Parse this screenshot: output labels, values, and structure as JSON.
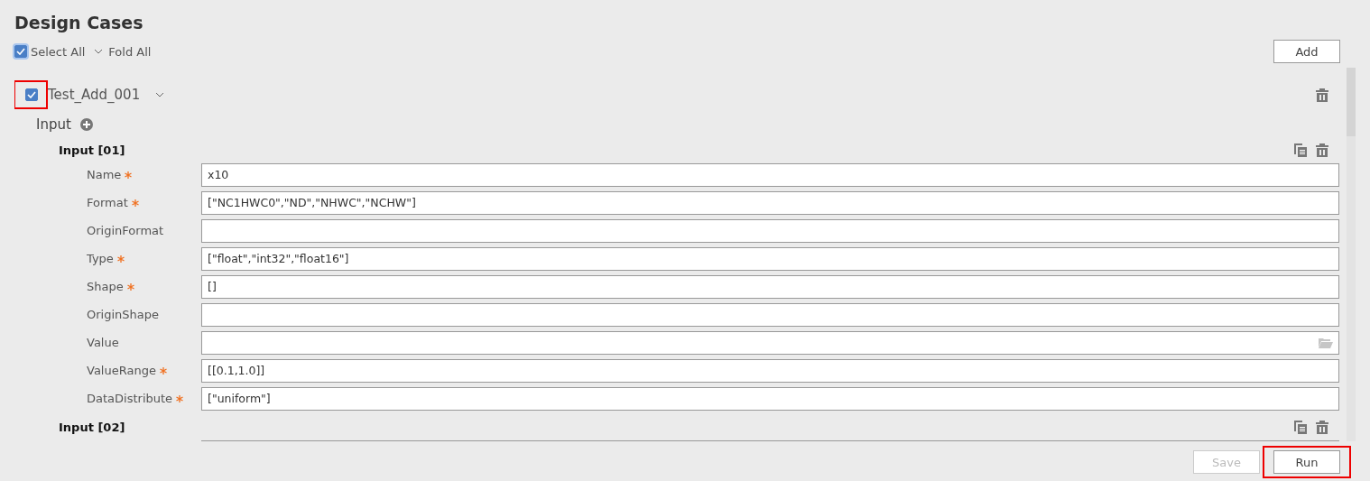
{
  "title": "Design Cases",
  "toolbar": {
    "select_all": {
      "label": "Select All",
      "checked": true
    },
    "fold_all": {
      "label": "Fold All"
    },
    "add_button": "Add"
  },
  "case": {
    "name": "Test_Add_001",
    "checked": true,
    "highlighted": true,
    "expanded": true,
    "input_section": {
      "label": "Input",
      "inputs": [
        {
          "title": "Input [01]",
          "fields": [
            {
              "label": "Name",
              "required": true,
              "kind": "text",
              "value": "x10"
            },
            {
              "label": "Format",
              "required": true,
              "kind": "text",
              "value": "[\"NC1HWC0\",\"ND\",\"NHWC\",\"NCHW\"]"
            },
            {
              "label": "OriginFormat",
              "required": false,
              "kind": "text"
            },
            {
              "label": "Type",
              "required": true,
              "kind": "text",
              "value": "[\"float\",\"int32\",\"float16\"]"
            },
            {
              "label": "Shape",
              "required": true,
              "kind": "text",
              "value": "[]"
            },
            {
              "label": "OriginShape",
              "required": false,
              "kind": "text"
            },
            {
              "label": "Value",
              "required": false,
              "kind": "file"
            },
            {
              "label": "ValueRange",
              "required": true,
              "kind": "text",
              "value": "[[0.1,1.0]]"
            },
            {
              "label": "DataDistribute",
              "required": true,
              "kind": "text",
              "value": "[\"uniform\"]"
            }
          ]
        },
        {
          "title": "Input [02]",
          "fields": [
            {
              "kind": "text"
            }
          ]
        }
      ]
    }
  },
  "footer": {
    "save": {
      "label": "Save",
      "disabled": true
    },
    "run": {
      "label": "Run",
      "disabled": false,
      "highlighted": true
    }
  }
}
